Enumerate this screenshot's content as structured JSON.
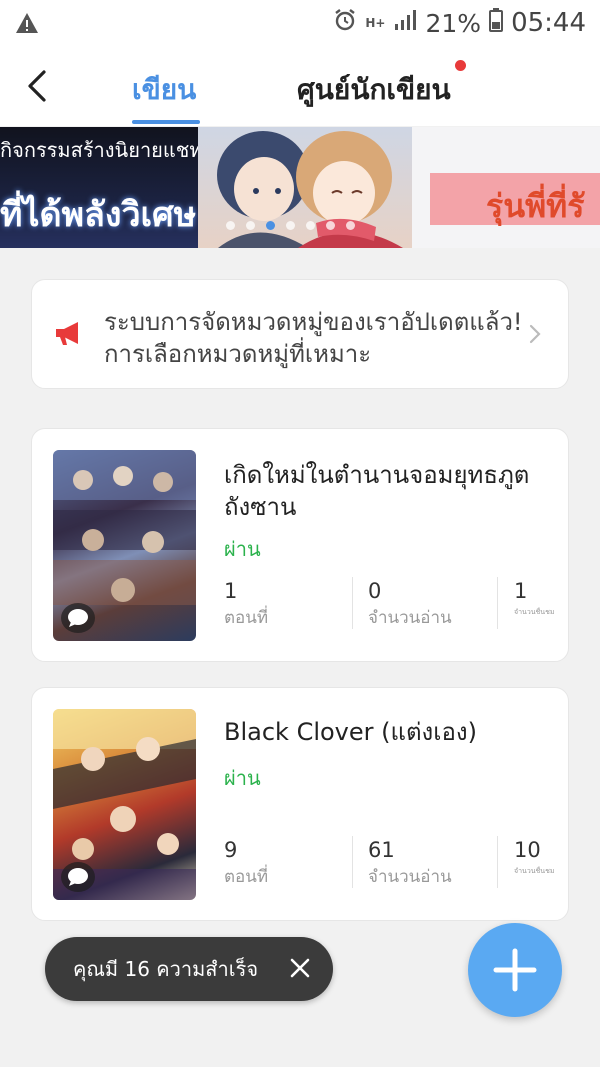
{
  "status_bar": {
    "battery_percent": "21%",
    "time": "05:44",
    "network": "H+"
  },
  "header": {
    "tab_write": "เขียน",
    "tab_writer_center": "ศูนย์นักเขียน"
  },
  "banner": {
    "left_line1": "กิจกรรมสร้างนิยายแชท",
    "left_line2": "ที่ได้พลังวิเศษ",
    "right_text": "รุ่นพี่ที่รั",
    "slide_count": 7,
    "active_slide": 3
  },
  "notice": {
    "text": "ระบบการจัดหมวดหมู่ของเราอัปเดตแล้ว! การเลือกหมวดหมู่ที่เหมาะ"
  },
  "stories": [
    {
      "title": "เกิดใหม่ในตำนานจอมยุทธภูตถังซาน",
      "status": "ผ่าน",
      "episodes": "1",
      "episodes_label": "ตอนที่",
      "reads": "0",
      "reads_label": "จำนวนอ่าน",
      "likes": "1",
      "likes_label": "จำนวนชื่นชม"
    },
    {
      "title": "Black Clover (แต่งเอง)",
      "status": "ผ่าน",
      "episodes": "9",
      "episodes_label": "ตอนที่",
      "reads": "61",
      "reads_label": "จำนวนอ่าน",
      "likes": "10",
      "likes_label": "จำนวนชื่นชม"
    }
  ],
  "toast": {
    "message": "คุณมี 16 ความสำเร็จ"
  },
  "colors": {
    "accent": "#4a90e2",
    "status_pass": "#2bb24c",
    "notice_icon": "#e83a3a",
    "fab": "#5aa9f2"
  }
}
